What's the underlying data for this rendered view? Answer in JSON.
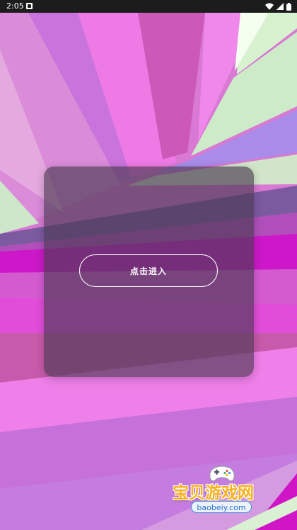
{
  "status_bar": {
    "time": "2:05",
    "app_icon": "app-notification-icon",
    "icons": [
      "wifi-icon",
      "signal-icon",
      "battery-icon"
    ]
  },
  "card": {
    "button_label": "点击进入"
  },
  "watermark": {
    "title": "宝贝游戏网",
    "domain": "baobeiy.com",
    "icon": "game-controller-icon"
  },
  "colors": {
    "background_primary": "#d66bd1",
    "card": "#4b3a52",
    "button_border": "#ffffff",
    "button_text": "#ffffff",
    "watermark_text": "#f7b31d",
    "watermark_domain": "#2d6fd0"
  }
}
